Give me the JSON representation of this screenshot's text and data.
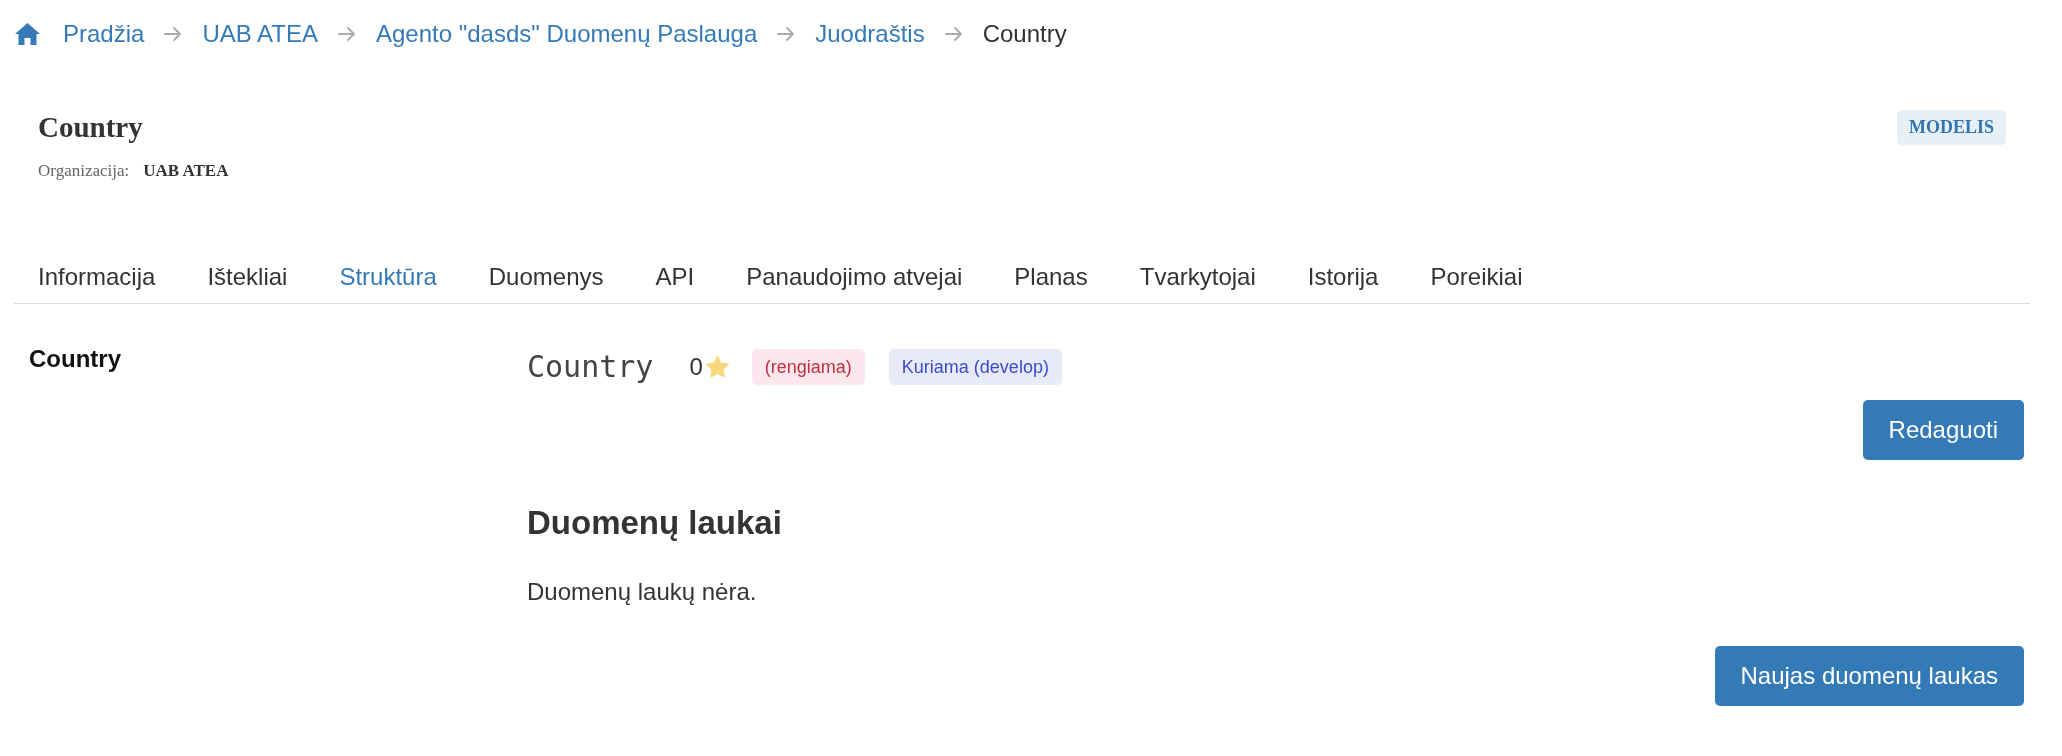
{
  "breadcrumb": [
    {
      "label": "Pradžia",
      "kind": "link"
    },
    {
      "label": "UAB ATEA",
      "kind": "link"
    },
    {
      "label": "Agento \"dasds\" Duomenų Paslauga",
      "kind": "link"
    },
    {
      "label": "Juodraštis",
      "kind": "link"
    },
    {
      "label": "Country",
      "kind": "current"
    }
  ],
  "header": {
    "title": "Country",
    "organization_label": "Organizacija:",
    "organization": "UAB ATEA",
    "type_badge": "MODELIS"
  },
  "tabs": [
    {
      "label": "Informacija",
      "selected": false
    },
    {
      "label": "Ištekliai",
      "selected": false
    },
    {
      "label": "Struktūra",
      "selected": true
    },
    {
      "label": "Duomenys",
      "selected": false
    },
    {
      "label": "API",
      "selected": false
    },
    {
      "label": "Panaudojimo atvejai",
      "selected": false
    },
    {
      "label": "Planas",
      "selected": false
    },
    {
      "label": "Tvarkytojai",
      "selected": false
    },
    {
      "label": "Istorija",
      "selected": false
    },
    {
      "label": "Poreikiai",
      "selected": false
    }
  ],
  "sidebar": {
    "title": "Country"
  },
  "model": {
    "name": "Country",
    "star_count": "0",
    "badges": [
      {
        "label": "(rengiama)",
        "kind": "danger"
      },
      {
        "label": "Kuriama (develop)",
        "kind": "info"
      }
    ],
    "edit_button": "Redaguoti"
  },
  "fields": {
    "title": "Duomenų laukai",
    "empty_text": "Duomenų laukų nėra.",
    "add_button": "Naujas duomenų laukas"
  }
}
